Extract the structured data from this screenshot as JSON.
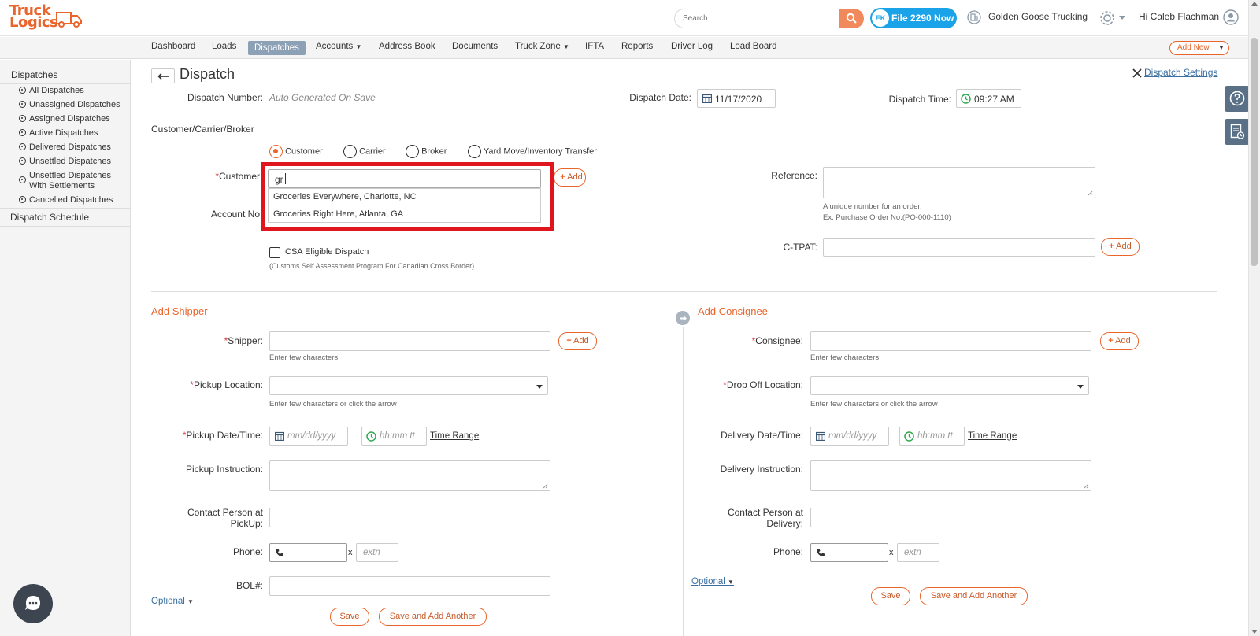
{
  "header": {
    "logo_top": "Truck",
    "logo_bottom": "Logics",
    "search_placeholder": "Search",
    "file_badge": "EK",
    "file_button": "File 2290 Now",
    "company": "Golden Goose Trucking",
    "greeting": "Hi Caleb Flachman"
  },
  "nav": {
    "items": [
      "Dashboard",
      "Loads",
      "Dispatches",
      "Accounts",
      "Address Book",
      "Documents",
      "Truck Zone",
      "IFTA",
      "Reports",
      "Driver Log",
      "Load Board"
    ],
    "active": "Dispatches",
    "add_new": "Add New"
  },
  "sidebar": {
    "heading": "Dispatches",
    "items": [
      "All Dispatches",
      "Unassigned Dispatches",
      "Assigned Dispatches",
      "Active Dispatches",
      "Delivered Dispatches",
      "Unsettled Dispatches",
      "Unsettled Dispatches With Settlements",
      "Cancelled Dispatches"
    ],
    "schedule": "Dispatch Schedule"
  },
  "page": {
    "title": "Dispatch",
    "settings_link": "Dispatch Settings",
    "dispatch_number_label": "Dispatch Number:",
    "dispatch_number_value": "Auto Generated On Save",
    "dispatch_date_label": "Dispatch Date:",
    "dispatch_date_value": "11/17/2020",
    "dispatch_time_label": "Dispatch Time:",
    "dispatch_time_value": "09:27 AM"
  },
  "ccb": {
    "section_label": "Customer/Carrier/Broker",
    "radios": [
      "Customer",
      "Carrier",
      "Broker",
      "Yard Move/Inventory Transfer"
    ],
    "selected": "Customer",
    "customer_label": "Customer",
    "customer_value": "gr",
    "suggestions": [
      "Groceries Everywhere, Charlotte, NC",
      "Groceries Right Here, Atlanta, GA"
    ],
    "add_label": "Add",
    "account_label": "Account No",
    "csa_label": "CSA Eligible Dispatch",
    "csa_hint": "(Customs Self Assessment Program For Canadian Cross Border)",
    "reference_label": "Reference:",
    "reference_hint1": "A unique number for an order.",
    "reference_hint2": "Ex. Purchase Order No.(PO-000-1110)",
    "ctpat_label": "C-TPAT:",
    "ctpat_add": "Add"
  },
  "shipper": {
    "title": "Add Shipper",
    "shipper_label": "Shipper:",
    "shipper_hint": "Enter few characters",
    "add_label": "Add",
    "pickup_location_label": "Pickup Location:",
    "pickup_location_hint": "Enter few characters or click the arrow",
    "pickup_datetime_label": "Pickup Date/Time:",
    "date_placeholder": "mm/dd/yyyy",
    "time_placeholder": "hh:mm tt",
    "time_range": "Time Range",
    "instruction_label": "Pickup Instruction:",
    "contact_label_1": "Contact Person at",
    "contact_label_2": "PickUp:",
    "phone_label": "Phone:",
    "ext_sep": "x",
    "ext_placeholder": "extn",
    "bol_label": "BOL#:",
    "optional": "Optional",
    "save": "Save",
    "save_add": "Save and Add Another"
  },
  "consignee": {
    "title": "Add Consignee",
    "consignee_label": "Consignee:",
    "consignee_hint": "Enter few characters",
    "add_label": "Add",
    "dropoff_label": "Drop Off Location:",
    "dropoff_hint": "Enter few characters or click the arrow",
    "delivery_datetime_label": "Delivery Date/Time:",
    "date_placeholder": "mm/dd/yyyy",
    "time_placeholder": "hh:mm tt",
    "time_range": "Time Range",
    "instruction_label": "Delivery Instruction:",
    "contact_label_1": "Contact Person at",
    "contact_label_2": "Delivery:",
    "phone_label": "Phone:",
    "ext_sep": "x",
    "ext_placeholder": "extn",
    "optional": "Optional",
    "save": "Save",
    "save_add": "Save and Add Another"
  },
  "colors": {
    "accent": "#e9652b",
    "highlight_box": "#e0161e",
    "file_blue": "#1aa3e8",
    "nav_active": "#8da1b6"
  }
}
